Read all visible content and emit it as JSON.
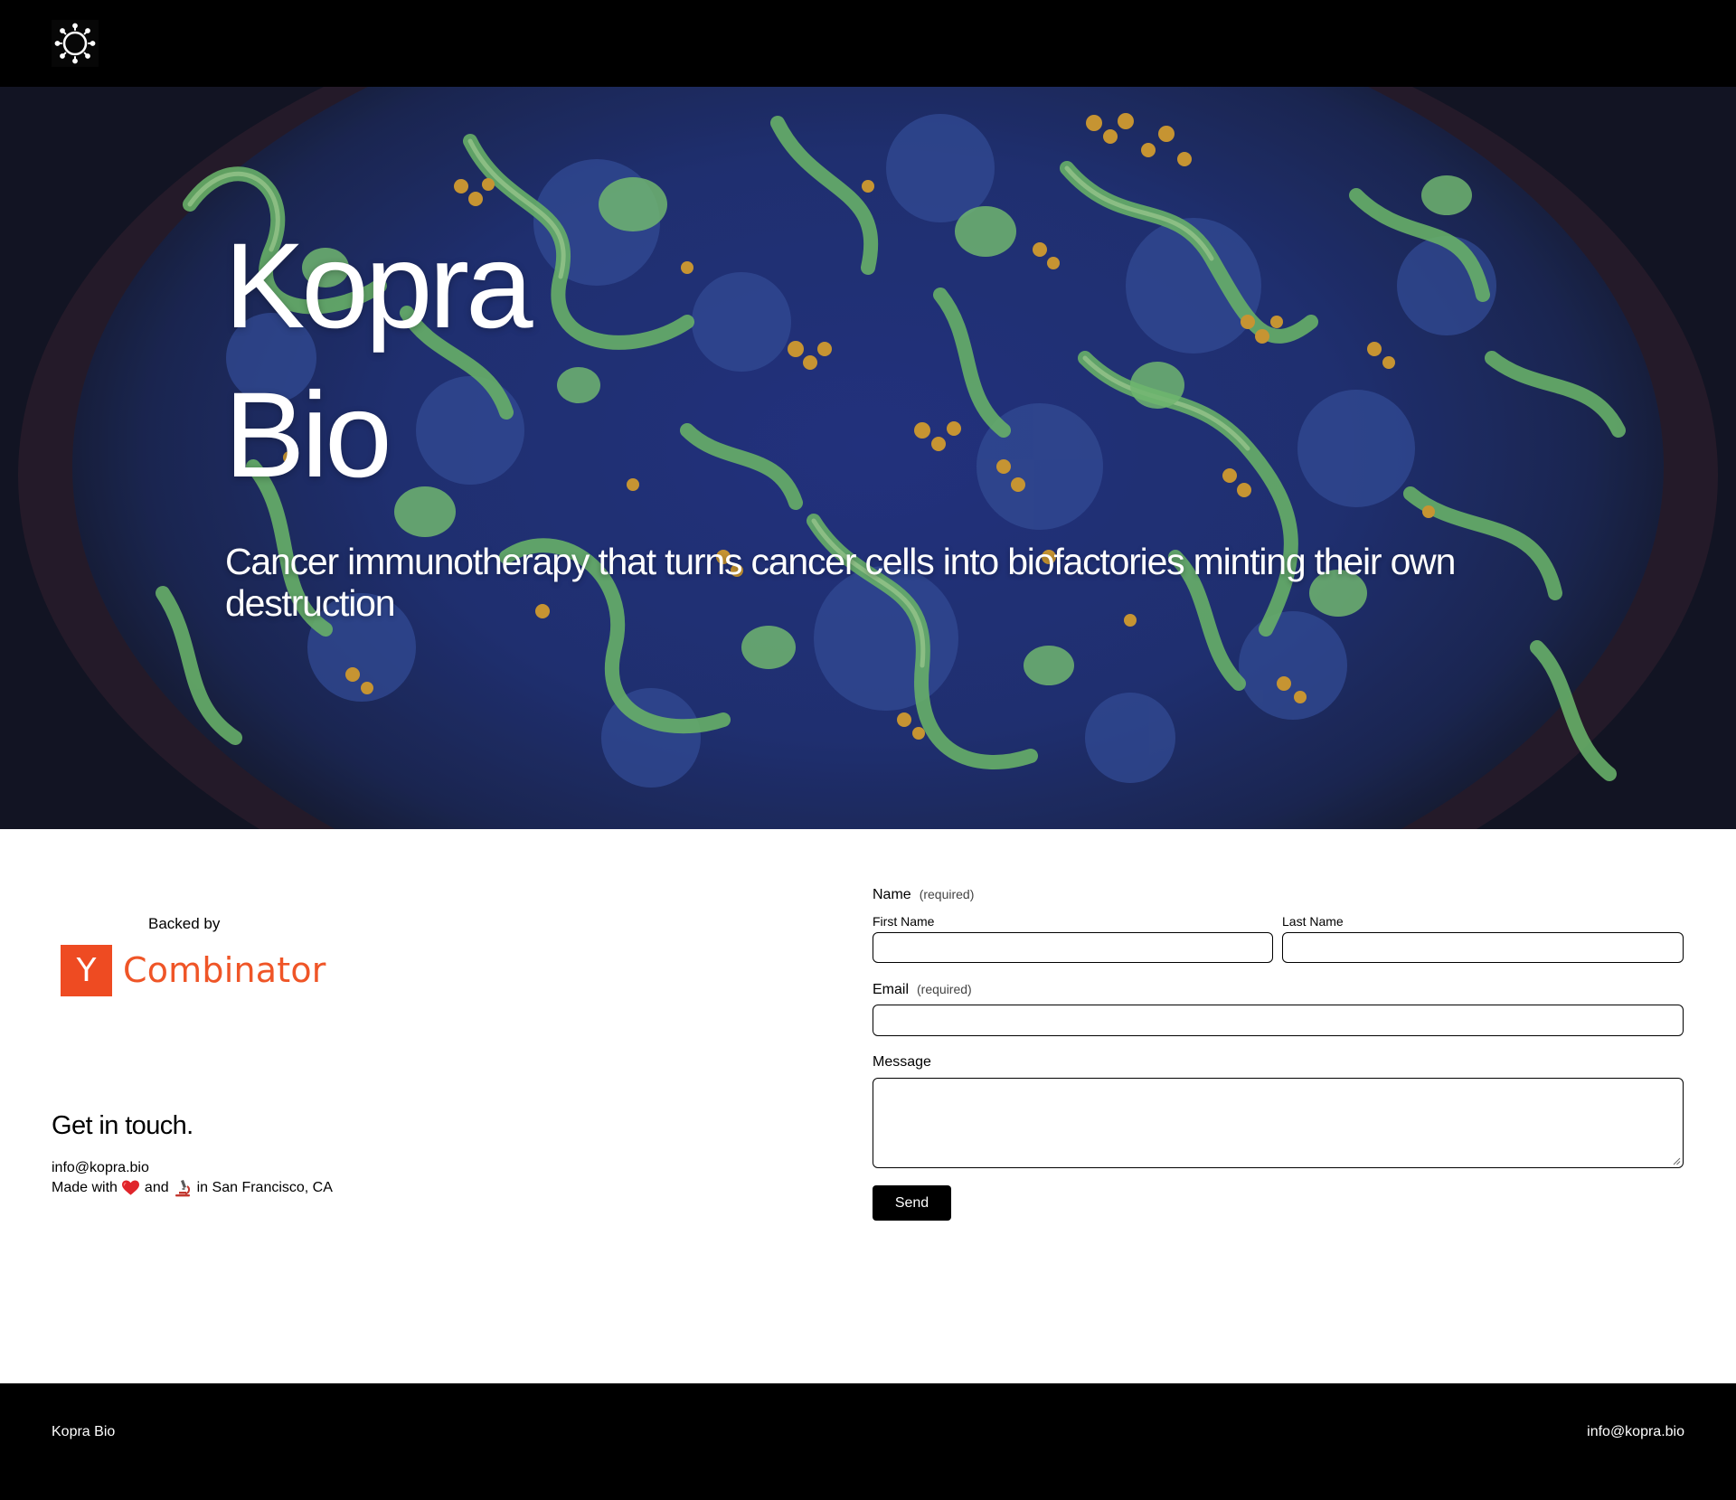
{
  "header": {
    "logo_icon": "virus-sun-icon"
  },
  "hero": {
    "title_line1": "Kopra",
    "title_line2": "Bio",
    "tagline": "Cancer immunotherapy that turns cancer cells into biofactories minting their own destruction",
    "background_icon": "cell-microscopy-image"
  },
  "backing": {
    "label": "Backed by",
    "yc_letter": "Y",
    "yc_word": "Combinator",
    "yc_color": "#ee4b22"
  },
  "contact": {
    "title": "Get in touch.",
    "email": "info@kopra.bio",
    "made_prefix": "Made with",
    "made_and": "and",
    "made_suffix": "in San Francisco, CA",
    "heart_icon": "heart-icon",
    "microscope_icon": "microscope-icon"
  },
  "form": {
    "name_label": "Name",
    "required_text": "(required)",
    "first_name_label": "First Name",
    "first_name_value": "",
    "last_name_label": "Last Name",
    "last_name_value": "",
    "email_label": "Email",
    "email_value": "",
    "message_label": "Message",
    "message_value": "",
    "send_label": "Send"
  },
  "footer": {
    "left_text": "Kopra Bio",
    "right_text": "info@kopra.bio"
  }
}
